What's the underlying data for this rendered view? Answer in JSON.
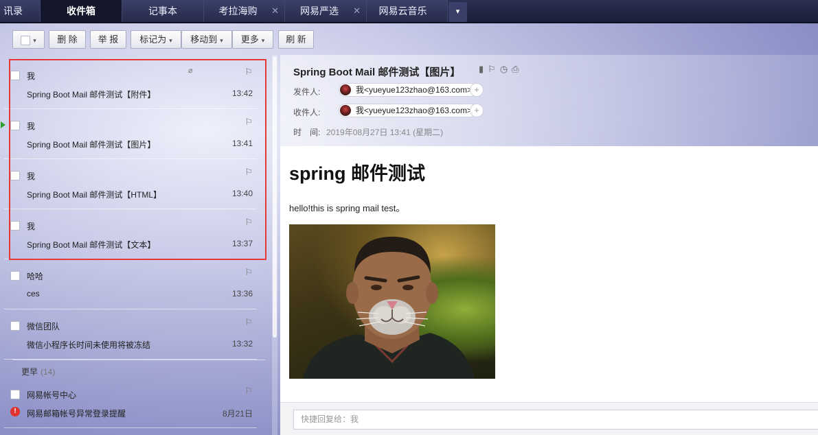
{
  "tabs": [
    {
      "label": "讯录",
      "active": false,
      "closable": false
    },
    {
      "label": "收件箱",
      "active": true,
      "closable": false
    },
    {
      "label": "记事本",
      "active": false,
      "closable": false
    },
    {
      "label": "考拉海购",
      "active": false,
      "closable": true
    },
    {
      "label": "网易严选",
      "active": false,
      "closable": true
    },
    {
      "label": "网易云音乐",
      "active": false,
      "closable": false
    }
  ],
  "tab_more_icon": "chevron-down-icon",
  "toolbar": {
    "select_all_caret": "▾",
    "delete": "删 除",
    "report": "举 报",
    "mark_as": "标记为",
    "move_to": "移动到",
    "more": "更多",
    "refresh": "刷 新"
  },
  "mails": [
    {
      "sender": "我",
      "subject": "Spring Boot Mail 邮件测试【附件】",
      "time": "13:42",
      "attachment": true,
      "current": false
    },
    {
      "sender": "我",
      "subject": "Spring Boot Mail 邮件测试【图片】",
      "time": "13:41",
      "attachment": false,
      "current": true
    },
    {
      "sender": "我",
      "subject": "Spring Boot Mail 邮件测试【HTML】",
      "time": "13:40",
      "attachment": false,
      "current": false
    },
    {
      "sender": "我",
      "subject": "Spring Boot Mail 邮件测试【文本】",
      "time": "13:37",
      "attachment": false,
      "current": false
    },
    {
      "sender": "哈哈",
      "subject": "ces",
      "time": "13:36",
      "attachment": false,
      "current": false
    },
    {
      "sender": "微信团队",
      "subject": "微信小程序长时间未使用将被冻结",
      "time": "13:32",
      "attachment": false,
      "current": false
    }
  ],
  "earlier_group": {
    "label": "更早",
    "count": "(14)"
  },
  "earlier_mails": [
    {
      "sender": "网易帐号中心",
      "subject": "网易邮箱帐号异常登录提醒",
      "time": "8月21日",
      "alert": true
    }
  ],
  "reading": {
    "title": "Spring Boot Mail 邮件测试【图片】",
    "from_label": "发件人:",
    "from_value": "我<yueyue123zhao@163.com>",
    "to_label": "收件人:",
    "to_value": "我<yueyue123zhao@163.com>",
    "time_label": "时　间:",
    "time_value": "2019年08月27日 13:41 (星期二)",
    "body_heading": "spring 邮件测试",
    "body_text": "hello!this is spring mail test。",
    "quick_reply_placeholder": "快捷回复给：我"
  },
  "colors": {
    "accent_red": "#e53935",
    "unread_marker": "#2ca02c",
    "tab_active_bg": "#14162b"
  }
}
